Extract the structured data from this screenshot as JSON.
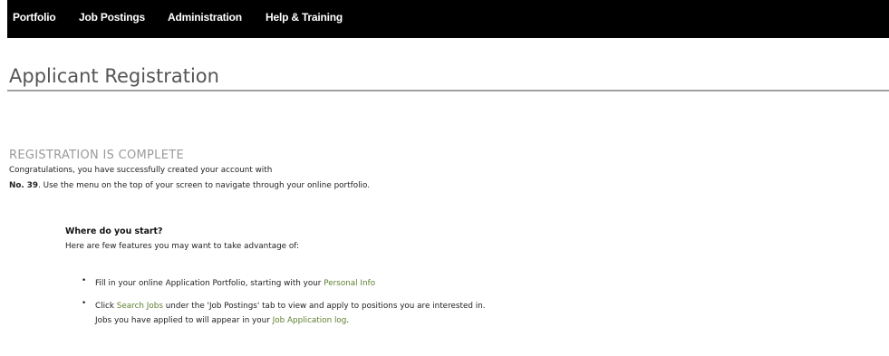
{
  "topnav": {
    "items": [
      {
        "label": "Portfolio"
      },
      {
        "label": "Job Postings"
      },
      {
        "label": "Administration"
      },
      {
        "label": "Help & Training"
      }
    ]
  },
  "page": {
    "title": "Applicant Registration"
  },
  "status": {
    "heading": "REGISTRATION IS COMPLETE",
    "line1": "Congratulations, you have successfully created your account with",
    "line2_bold": "No. 39",
    "line2_rest": ". Use the menu on the top of your screen to navigate through your online portfolio."
  },
  "start": {
    "heading": "Where do you start?",
    "intro": "Here are few features you may want to take advantage of:",
    "bullets": [
      {
        "prefix": "Fill in your online Application Portfolio, starting with your ",
        "link": "Personal Info"
      },
      {
        "prefix": "Click ",
        "link": "Search Jobs",
        "middle": " under the 'Job Postings' tab to view and apply to positions you are interested in.",
        "line2_prefix": "Jobs you have applied to will appear in your ",
        "line2_link": "Job Application log",
        "line2_suffix": "."
      }
    ]
  },
  "colors": {
    "nav_background": "#000000",
    "nav_text": "#ffffff",
    "link": "#5c7f2e",
    "title": "#555555",
    "status_heading": "#9a9a9a",
    "rule": "#a0a0a0"
  }
}
